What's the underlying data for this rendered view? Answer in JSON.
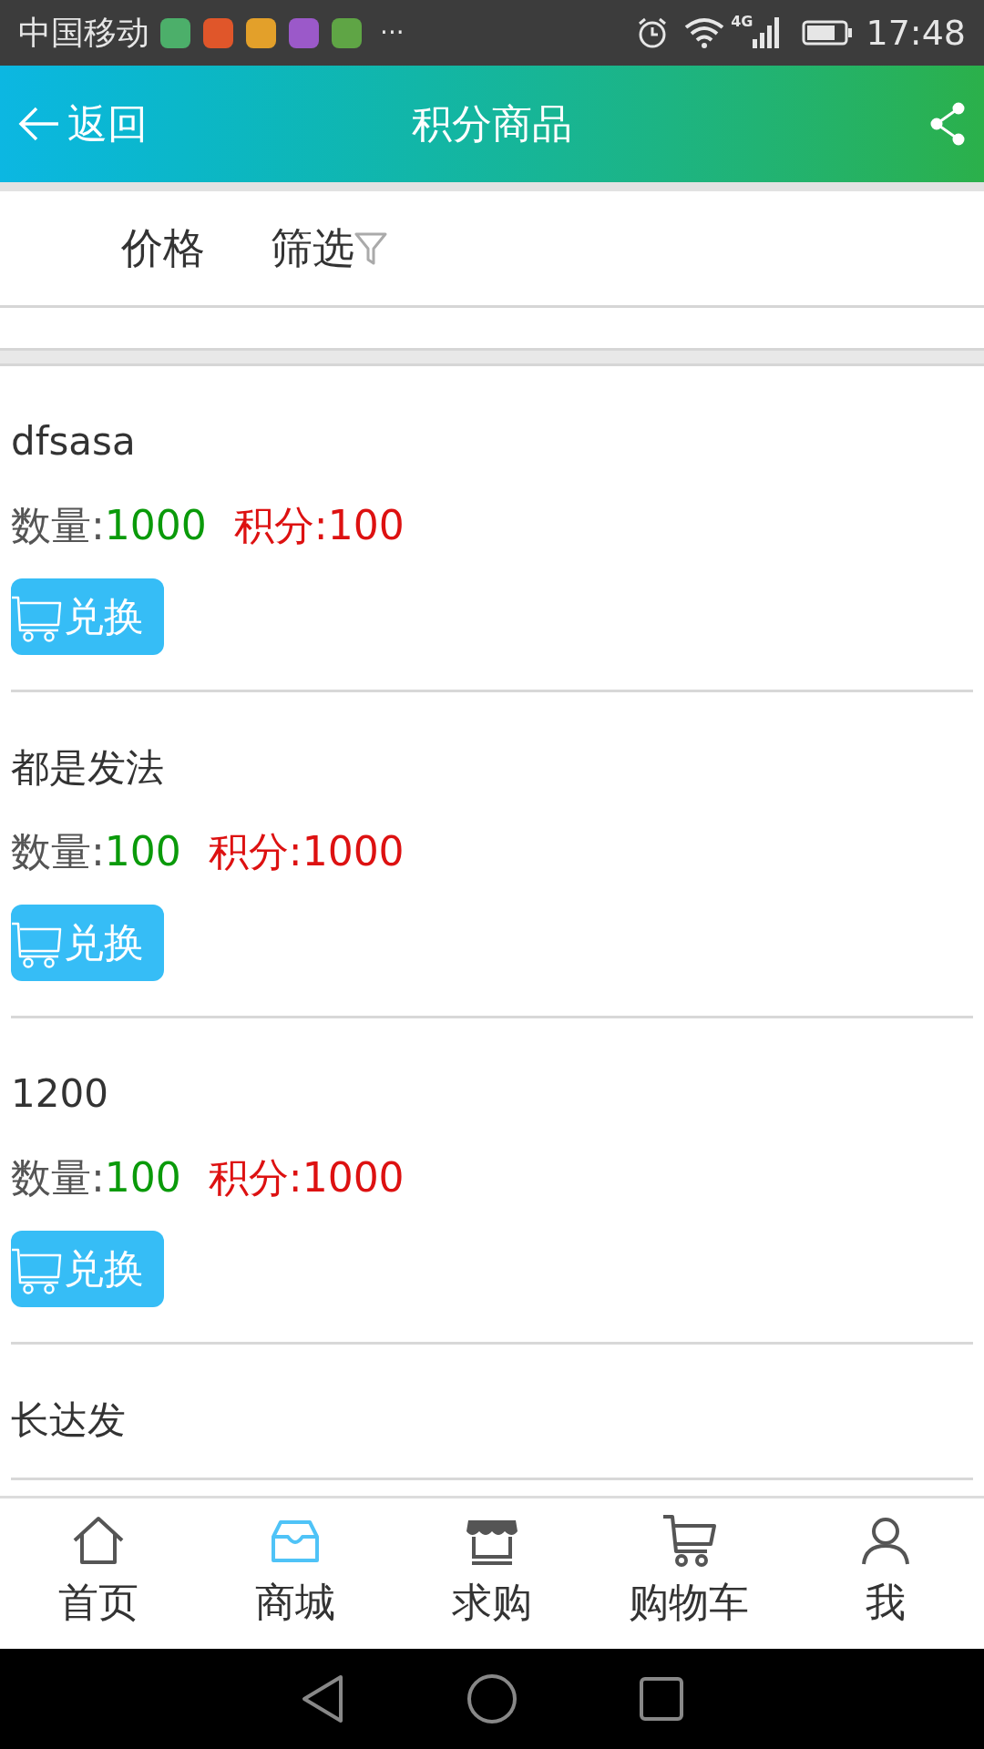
{
  "status_bar": {
    "carrier": "中国移动",
    "notifications": [
      {
        "color": "#4caf6a"
      },
      {
        "color": "#e0562a"
      },
      {
        "color": "#e3a02a"
      },
      {
        "color": "#9b59c9"
      },
      {
        "color": "#5fa545"
      }
    ],
    "more": "···",
    "network": "4G",
    "time": "17:48"
  },
  "header": {
    "back_label": "返回",
    "title": "积分商品"
  },
  "filters": [
    {
      "label": "价格",
      "kind": "plain"
    },
    {
      "label": "筛选",
      "kind": "filter"
    }
  ],
  "products": [
    {
      "name": "dfsasa",
      "quantity_label": "数量:",
      "quantity": "1000",
      "points": "积分:100",
      "button": "兑换"
    },
    {
      "name": "都是发法",
      "quantity_label": "数量:",
      "quantity": "100",
      "points": "积分:1000",
      "button": "兑换"
    },
    {
      "name": "1200",
      "quantity_label": "数量:",
      "quantity": "100",
      "points": "积分:1000",
      "button": "兑换"
    },
    {
      "name": "长达发"
    }
  ],
  "bottom_nav": [
    {
      "label": "首页",
      "kind": "home",
      "selected": false
    },
    {
      "label": "商城",
      "kind": "inbox",
      "selected": true
    },
    {
      "label": "求购",
      "kind": "store",
      "selected": false
    },
    {
      "label": "购物车",
      "kind": "cart",
      "selected": false
    },
    {
      "label": "我",
      "kind": "user",
      "selected": false
    }
  ]
}
